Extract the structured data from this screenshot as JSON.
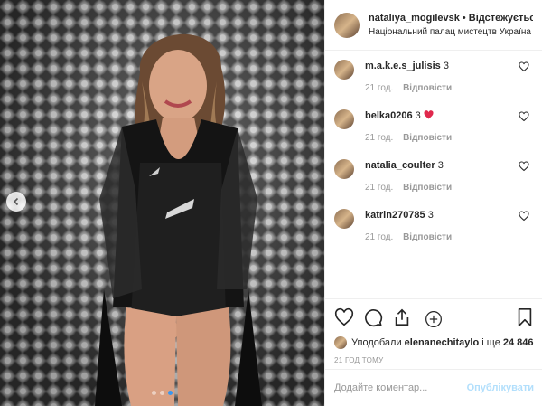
{
  "post": {
    "username": "nataliya_mogilevsk",
    "separator": "•",
    "follow_status": "Відстежується",
    "location": "Національний палац мистецтв Україна"
  },
  "comments": [
    {
      "user": "m.a.k.e.s_julisis",
      "text": "3",
      "time": "21 год.",
      "reply": "Відповісти"
    },
    {
      "user": "belka0206",
      "text": "3",
      "emoji": "heart",
      "time": "21 год.",
      "reply": "Відповісти"
    },
    {
      "user": "natalia_coulter",
      "text": "3",
      "time": "21 год.",
      "reply": "Відповісти"
    },
    {
      "user": "katrin270785",
      "text": "3",
      "time": "21 год.",
      "reply": "Відповісти"
    }
  ],
  "likes": {
    "prefix": "Уподобали",
    "user": "elenanechitaylo",
    "joiner": "і ще",
    "count": "24 846"
  },
  "time_ago": "21 ГОД ТОМУ",
  "comment_box": {
    "placeholder": "Додайте коментар...",
    "publish_label": "Опублікувати"
  },
  "icons": [
    "heart-icon",
    "comment-icon",
    "share-icon",
    "bookmark-icon",
    "plus-circle-icon",
    "chevron-left-icon"
  ],
  "colors": {
    "link": "#3897f0",
    "publish_disabled": "#b2dffc",
    "muted": "#999999",
    "emoji_heart": "#e0284c"
  },
  "carousel": {
    "slides": 3,
    "active": 3
  }
}
